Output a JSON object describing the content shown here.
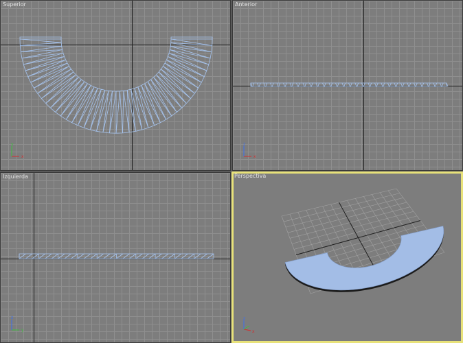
{
  "viewports": {
    "top": {
      "label": "Superior"
    },
    "front": {
      "label": "Anterior"
    },
    "left": {
      "label": "Izquierda"
    },
    "perspective": {
      "label": "Perspectiva"
    }
  },
  "colors": {
    "viewport_bg": "#7d7d7d",
    "grid_line": "#8f8f8f",
    "home_axis": "#1e1e1e",
    "wireframe": "#a6c4ef",
    "shaded_surface": "#a3bde6",
    "active_border": "#e8e27a"
  },
  "tripod": {
    "x_label": "x",
    "y_label": "y",
    "z_label": "z",
    "x_color": "#d22f2f",
    "y_color": "#3fbf3f",
    "z_color": "#3b6ff0"
  },
  "active_viewport": "perspective"
}
